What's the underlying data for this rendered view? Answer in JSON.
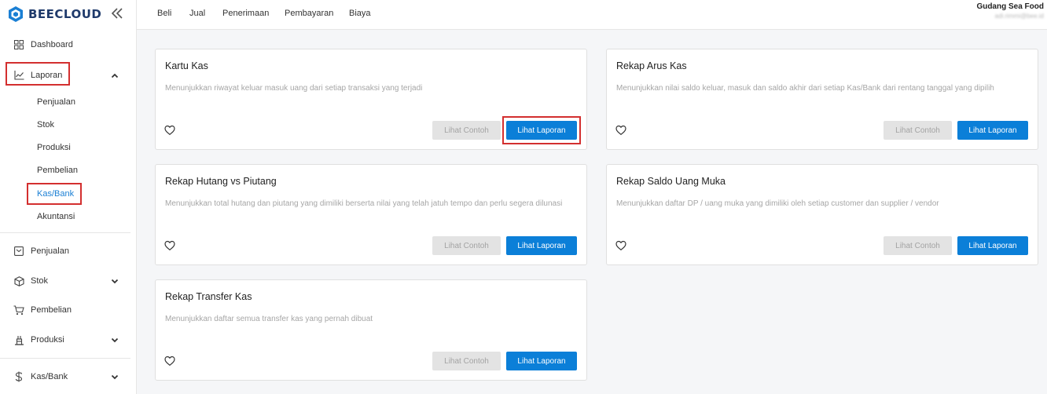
{
  "app": {
    "brand": "BEECLOUD"
  },
  "sidebar": {
    "items": [
      {
        "label": "Dashboard",
        "icon": "grid-icon"
      },
      {
        "label": "Laporan",
        "icon": "chart-line-icon"
      },
      {
        "label": "Penjualan",
        "icon": "receipt-icon"
      },
      {
        "label": "Stok",
        "icon": "box-icon"
      },
      {
        "label": "Pembelian",
        "icon": "cart-icon"
      },
      {
        "label": "Produksi",
        "icon": "factory-icon"
      },
      {
        "label": "Kas/Bank",
        "icon": "dollar-icon"
      }
    ],
    "laporan_sub": [
      "Penjualan",
      "Stok",
      "Produksi",
      "Pembelian",
      "Kas/Bank",
      "Akuntansi"
    ]
  },
  "topnav": {
    "items": [
      "Beli",
      "Jual",
      "Penerimaan",
      "Pembayaran",
      "Biaya"
    ],
    "company": "Gudang Sea Food",
    "email": "adi.rimmi@bee.id"
  },
  "cards": [
    {
      "title": "Kartu Kas",
      "desc": "Menunjukkan riwayat keluar masuk uang dari setiap transaksi yang terjadi",
      "contoh": "Lihat Contoh",
      "lihat": "Lihat Laporan"
    },
    {
      "title": "Rekap Arus Kas",
      "desc": "Menunjukkan nilai saldo keluar, masuk dan saldo akhir dari setiap Kas/Bank dari rentang tanggal yang dipilih",
      "contoh": "Lihat Contoh",
      "lihat": "Lihat Laporan"
    },
    {
      "title": "Rekap Hutang vs Piutang",
      "desc": "Menunjukkan total hutang dan piutang yang dimiliki berserta nilai yang telah jatuh tempo dan perlu segera dilunasi",
      "contoh": "Lihat Contoh",
      "lihat": "Lihat Laporan"
    },
    {
      "title": "Rekap Saldo Uang Muka",
      "desc": "Menunjukkan daftar DP / uang muka yang dimiliki oleh setiap customer dan supplier / vendor",
      "contoh": "Lihat Contoh",
      "lihat": "Lihat Laporan"
    },
    {
      "title": "Rekap Transfer Kas",
      "desc": "Menunjukkan daftar semua transfer kas yang pernah dibuat",
      "contoh": "Lihat Contoh",
      "lihat": "Lihat Laporan"
    }
  ],
  "colors": {
    "accent": "#0b7fd8",
    "brand": "#1f3a6b",
    "highlight": "#d32f2f"
  }
}
